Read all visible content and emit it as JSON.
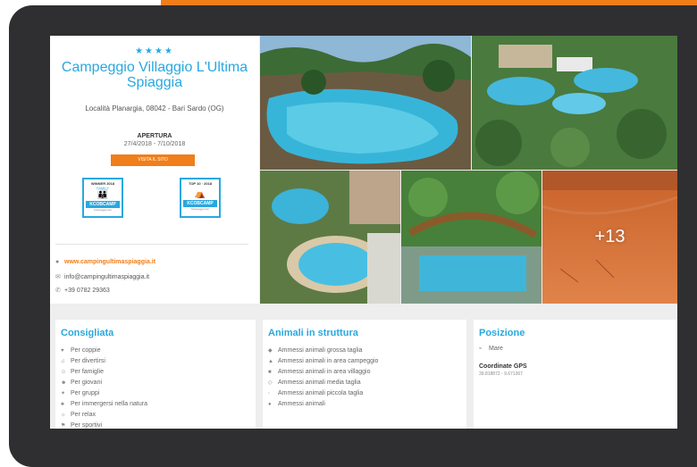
{
  "campsite": {
    "stars": "★★★★",
    "name": "Campeggio Villaggio L'Ultima Spiaggia",
    "address": "Località Planargia, 08042 - Bari Sardo (OG)",
    "apertura_label": "APERTURA",
    "apertura_dates": "27/4/2018 - 7/10/2018",
    "visit_label": "VISITA IL SITO"
  },
  "badges": [
    {
      "top": "WINNER 2018",
      "mid": "FAMILY",
      "band": "KCOBCAMP",
      "sub": "Campeggi.com"
    },
    {
      "top": "TOP 10 · 2018",
      "mid": "",
      "band": "KCOBCAMP",
      "sub": "Campeggi.com"
    }
  ],
  "contacts": {
    "website": "www.campingultimaspiaggia.it",
    "email": "info@campingultimaspiaggia.it",
    "phone": "+39 0782 29363"
  },
  "gallery": {
    "more_count": "+13"
  },
  "consigliata": {
    "title": "Consigliata",
    "items": [
      "Per coppie",
      "Per divertirsi",
      "Per famiglie",
      "Per giovani",
      "Per gruppi",
      "Per immergersi nella natura",
      "Per relax",
      "Per sportivi"
    ]
  },
  "animali": {
    "title": "Animali in struttura",
    "items": [
      "Ammessi animali grossa taglia",
      "Ammessi animali in area campeggio",
      "Ammessi animali in area villaggio",
      "Ammessi animali media taglia",
      "Ammessi animali piccola taglia",
      "Ammessi animali"
    ]
  },
  "posizione": {
    "title": "Posizione",
    "mare": "Mare",
    "gps_label": "Coordinate GPS",
    "gps_value": "39.818872 - 9.671367"
  },
  "colors": {
    "accent_blue": "#29a8e0",
    "accent_orange": "#f07e1a",
    "device_frame": "#2f2f31"
  }
}
